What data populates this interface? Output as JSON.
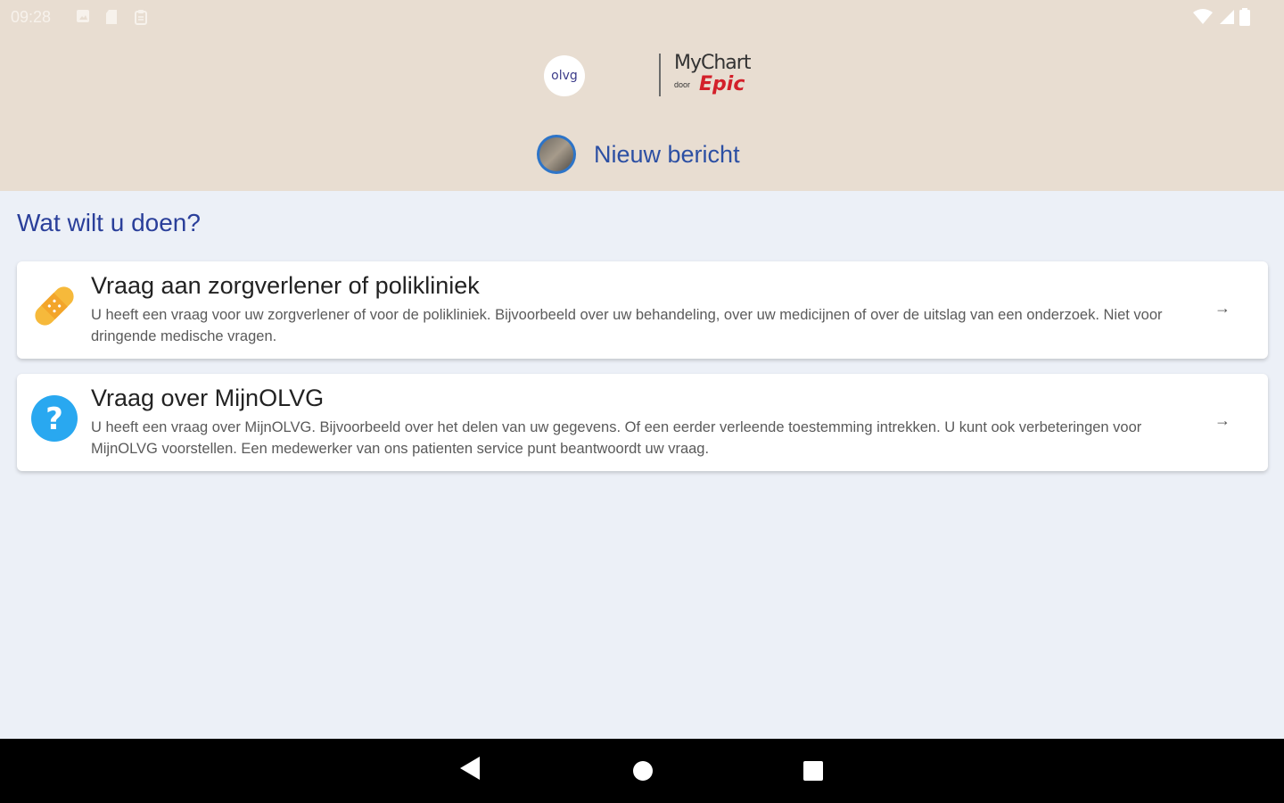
{
  "status_bar": {
    "time": "09:28",
    "notification_icons": [
      "photo-icon",
      "sd-card-icon",
      "clipboard-icon"
    ],
    "right_icons": [
      "wifi-icon",
      "signal-icon",
      "battery-icon"
    ]
  },
  "header": {
    "logos": {
      "olvg": "olvg",
      "mychart": "MyChart",
      "mychart_by": "door",
      "epic": "Epic"
    },
    "title": "Nieuw bericht"
  },
  "main": {
    "section_title": "Wat wilt u doen?",
    "options": [
      {
        "title": "Vraag aan zorgverlener of polikliniek",
        "description": "U heeft een vraag voor uw zorgverlener of voor de polikliniek. Bijvoorbeeld over uw behandeling, over uw medicijnen of over de uitslag van een onderzoek. Niet voor dringende medische vragen.",
        "icon": "bandage-icon",
        "arrow": "→"
      },
      {
        "title": "Vraag over MijnOLVG",
        "description": "U heeft een vraag over MijnOLVG. Bijvoorbeeld over het delen van uw gegevens. Of een eerder verleende toestemming intrekken. U kunt ook verbeteringen voor MijnOLVG voorstellen. Een medewerker van ons patienten service punt beantwoordt uw vraag.",
        "icon": "question-icon",
        "arrow": "→"
      }
    ]
  },
  "nav_bar": {
    "buttons": [
      "back-icon",
      "home-icon",
      "recents-icon"
    ]
  },
  "colors": {
    "header_bg": "#e8ddd1",
    "page_bg": "#ecf0f7",
    "accent_blue": "#2a3f9a",
    "bandage_orange": "#f6b93b",
    "question_blue": "#29a8f0",
    "epic_red": "#d3202a"
  }
}
